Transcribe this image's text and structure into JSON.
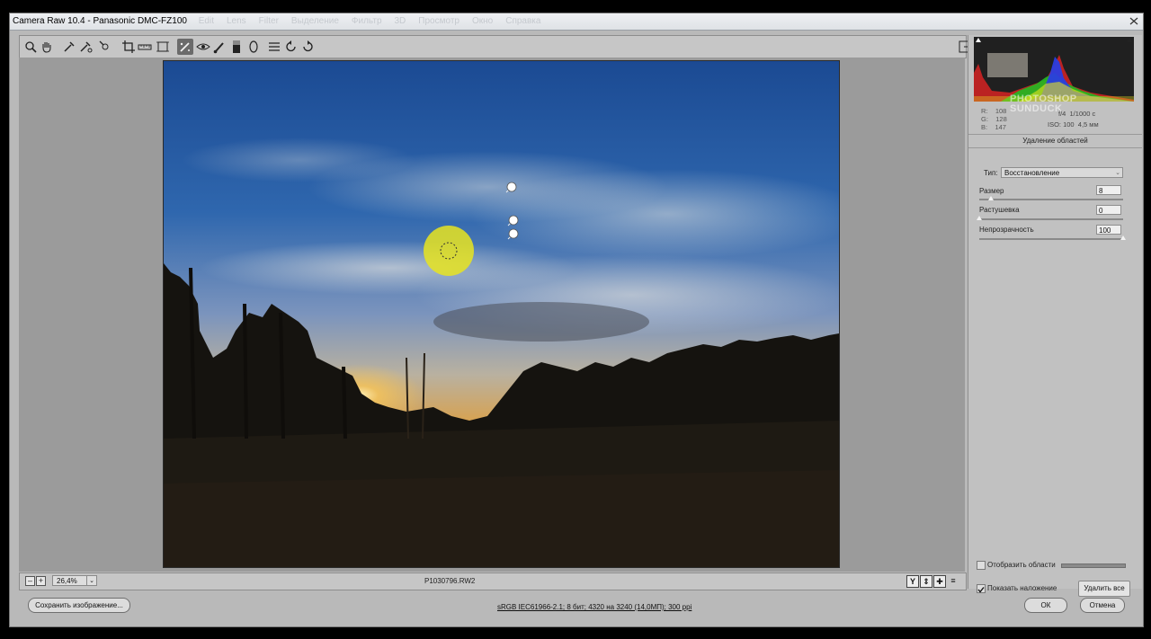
{
  "window": {
    "title": "Camera Raw 10.4  -  Panasonic DMC-FZ100",
    "ghost_menu": [
      "Edit",
      "Lens",
      "Filter",
      "Выделение",
      "Фильтр",
      "3D",
      "Просмотр",
      "Окно",
      "Справка"
    ]
  },
  "toolbar": {
    "tools": [
      "zoom-tool",
      "hand-tool",
      "white-balance-tool",
      "color-sampler-tool",
      "targeted-adjustment-tool",
      "crop-tool",
      "straighten-tool",
      "transform-tool",
      "spot-removal-tool",
      "red-eye-tool",
      "adjustment-brush-tool",
      "graduated-filter-tool",
      "radial-filter-tool",
      "preferences-tool",
      "rotate-left-tool",
      "rotate-right-tool"
    ],
    "active_tool": "spot-removal-tool"
  },
  "status": {
    "zoom": "26,4%",
    "filename": "P1030796.RW2",
    "view_buttons": [
      "Y",
      "⇕",
      "✚",
      "≡"
    ]
  },
  "panel": {
    "rgb": {
      "r_label": "R:",
      "r": "108",
      "g_label": "G:",
      "g": "128",
      "b_label": "B:",
      "b": "147"
    },
    "watermark": [
      "PHOTOSHOP",
      "SUNDUCK"
    ],
    "aperture": "f/4",
    "shutter": "1/1000 с",
    "iso": "ISO: 100",
    "focal": "4,5 мм",
    "title": "Удаление областей",
    "type_label": "Тип:",
    "type_value": "Восстановление",
    "size_label": "Размер",
    "size_value": "8",
    "feather_label": "Растушевка",
    "feather_value": "0",
    "opacity_label": "Непрозрачность",
    "opacity_value": "100",
    "sliders": {
      "size": 0.08,
      "feather": 0.0,
      "opacity": 1.0
    },
    "show_spots_label": "Отобразить области",
    "show_spots_checked": false,
    "show_overlay_label": "Показать наложение",
    "show_overlay_checked": true,
    "clear_all": "Удалить все"
  },
  "footer": {
    "save": "Сохранить изображение...",
    "color_info": "sRGB IEC61966-2.1; 8 бит; 4320 на 3240 (14,0МП); 300 ppi",
    "ok": "ОК",
    "cancel": "Отмена"
  },
  "colors": {
    "highlight": "#e8e420",
    "sky_top": "#1f4f9a",
    "sky_mid": "#6f93c6",
    "sun": "#f4c35a"
  }
}
